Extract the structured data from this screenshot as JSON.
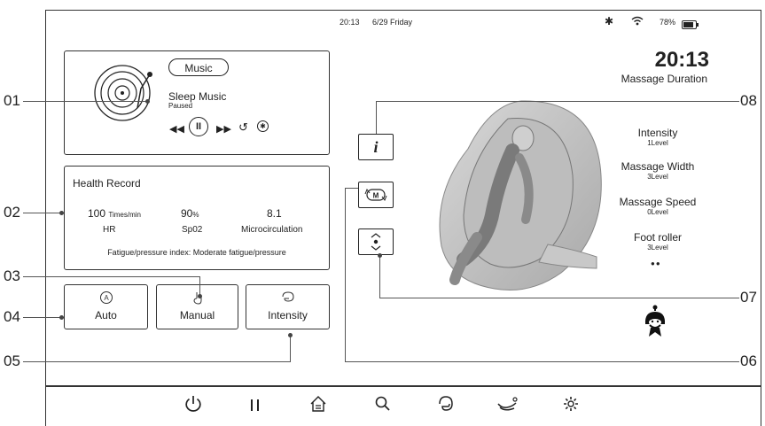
{
  "status": {
    "time": "20:13",
    "date": "6/29 Friday",
    "battery": "78%"
  },
  "callouts": {
    "c01": "01",
    "c02": "02",
    "c03": "03",
    "c04": "04",
    "c05": "05",
    "c06": "06",
    "c07": "07",
    "c08": "08"
  },
  "music": {
    "button": "Music",
    "track": "Sleep Music",
    "state": "Paused"
  },
  "health": {
    "title": "Health Record",
    "hr_value": "100",
    "hr_unit": "Times/min",
    "hr_label": "HR",
    "spo2_value": "90",
    "spo2_unit": "%",
    "spo2_label": "Sp02",
    "micro_value": "8.1",
    "micro_label": "Microcirculation",
    "fatigue": "Fatigue/pressure index: Moderate fatigue/pressure"
  },
  "modes": {
    "auto": "Auto",
    "manual": "Manual",
    "intensity": "Intensity"
  },
  "duration": {
    "time": "20:13",
    "label": "Massage Duration"
  },
  "settings": [
    {
      "title": "Intensity",
      "value": "1Level"
    },
    {
      "title": "Massage Width",
      "value": "3Level"
    },
    {
      "title": "Massage Speed",
      "value": "0Level"
    },
    {
      "title": "Foot roller",
      "value": "3Level"
    }
  ],
  "side_buttons": {
    "info": "i",
    "m": "M"
  },
  "nav": [
    "power-icon",
    "pause-icon",
    "home-icon",
    "search-icon",
    "massage-hand-icon",
    "recline-icon",
    "settings-gear-icon"
  ]
}
